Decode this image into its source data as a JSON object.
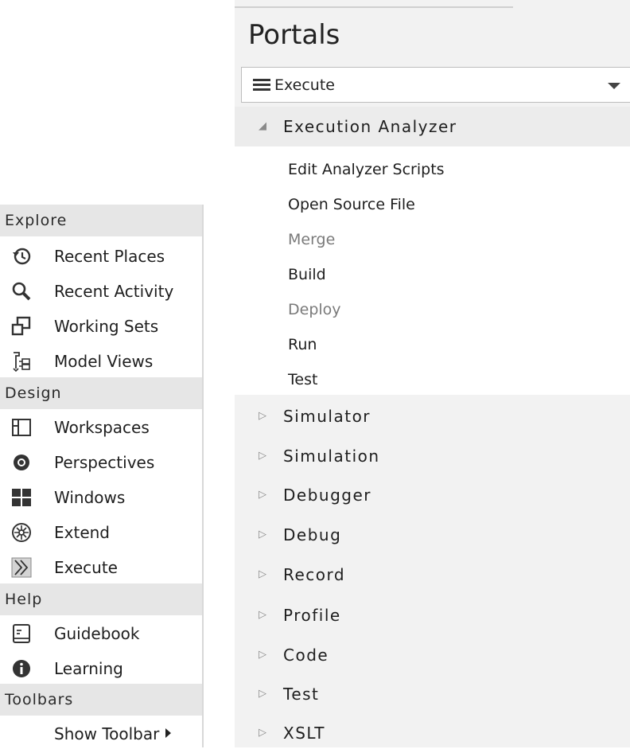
{
  "left_menu": {
    "sections": [
      {
        "title": "Explore",
        "items": [
          {
            "label": "Recent Places",
            "icon": "history-icon"
          },
          {
            "label": "Recent Activity",
            "icon": "search-icon"
          },
          {
            "label": "Working Sets",
            "icon": "working-sets-icon"
          },
          {
            "label": "Model Views",
            "icon": "model-views-icon"
          }
        ]
      },
      {
        "title": "Design",
        "items": [
          {
            "label": "Workspaces",
            "icon": "workspaces-icon"
          },
          {
            "label": "Perspectives",
            "icon": "eye-icon"
          },
          {
            "label": "Windows",
            "icon": "windows-grid-icon"
          },
          {
            "label": "Extend",
            "icon": "extend-icon"
          },
          {
            "label": "Execute",
            "icon": "execute-icon"
          }
        ]
      },
      {
        "title": "Help",
        "items": [
          {
            "label": "Guidebook",
            "icon": "guidebook-icon"
          },
          {
            "label": "Learning",
            "icon": "info-icon"
          }
        ]
      },
      {
        "title": "Toolbars",
        "items": [
          {
            "label": "Show Toolbar",
            "icon": ""
          }
        ]
      }
    ]
  },
  "portal": {
    "title": "Portals",
    "dropdown_value": "Execute",
    "expanded_group": {
      "label": "Execution Analyzer",
      "children": [
        {
          "label": "Edit Analyzer Scripts",
          "enabled": true
        },
        {
          "label": "Open Source File",
          "enabled": true
        },
        {
          "label": "Merge",
          "enabled": false
        },
        {
          "label": "Build",
          "enabled": true
        },
        {
          "label": "Deploy",
          "enabled": false
        },
        {
          "label": "Run",
          "enabled": true
        },
        {
          "label": "Test",
          "enabled": true
        }
      ]
    },
    "collapsed_groups": [
      "Simulator",
      "Simulation",
      "Debugger",
      "Debug",
      "Record",
      "Profile",
      "Code",
      "Test",
      "XSLT"
    ]
  },
  "colors": {
    "section_header_bg": "#e6e6e6",
    "portal_bg": "#f2f2f2",
    "disabled_text": "#7a7a7a"
  }
}
